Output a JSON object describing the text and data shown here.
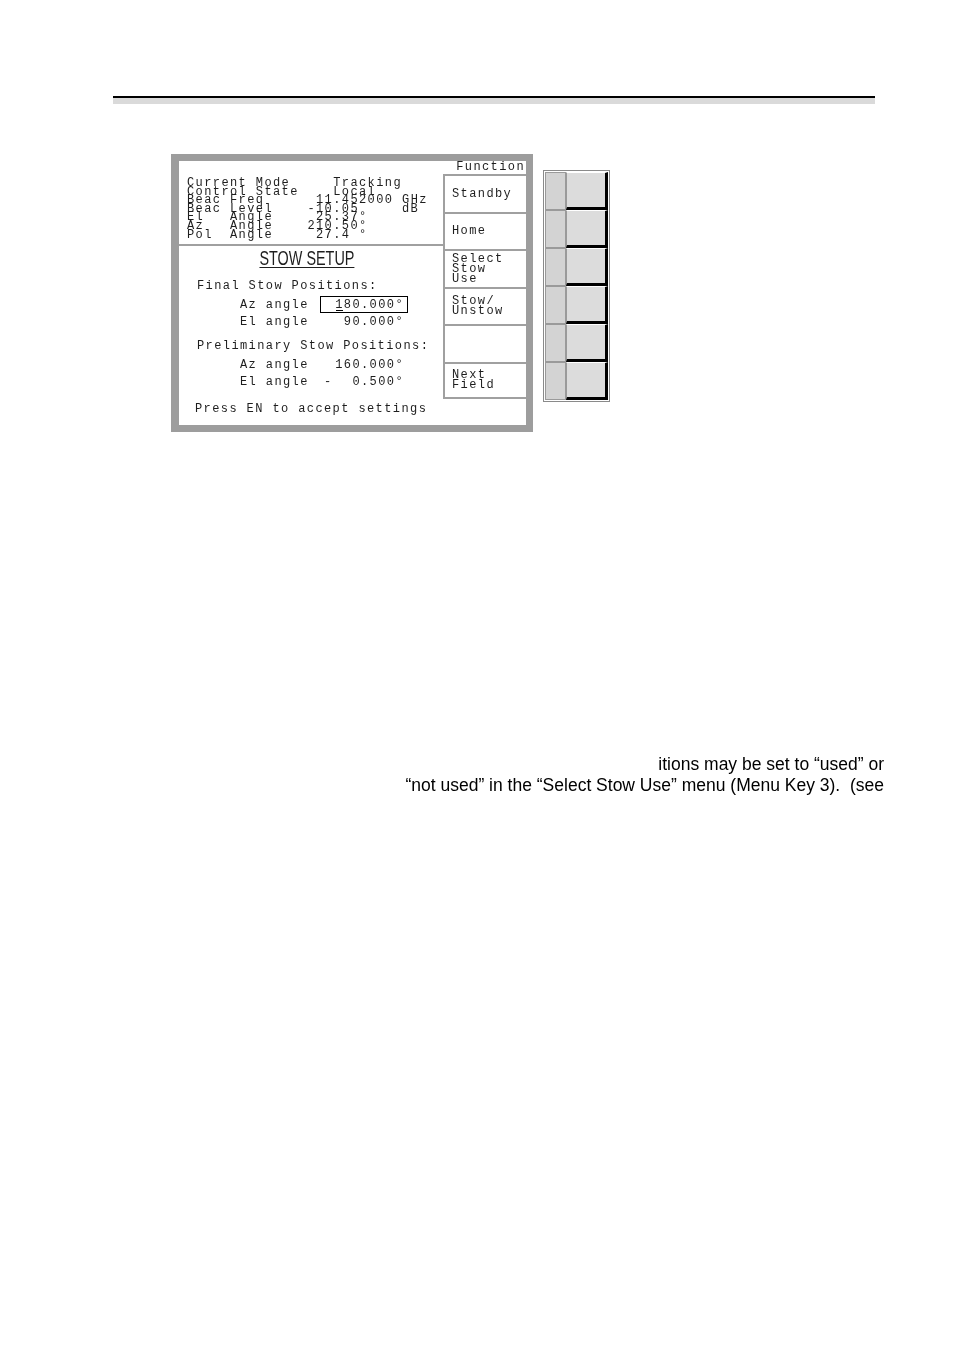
{
  "screen": {
    "status": [
      {
        "label": "Current Mode",
        "value": "Tracking"
      },
      {
        "label": "Control State",
        "value": "Local"
      },
      {
        "label": "Beac Freq",
        "value": "11.452000",
        "unit": "GHz"
      },
      {
        "label": "Beac Level",
        "value": "-10.05",
        "unit": "dB"
      },
      {
        "label": "El   Angle",
        "value": "25.37°"
      },
      {
        "label": "Az   Angle",
        "value": "210.50°"
      },
      {
        "label": "Pol  Angle",
        "value": "27.4 °"
      }
    ],
    "title": "STOW SETUP",
    "sections": [
      {
        "heading": "Final Stow Positions:",
        "fields": [
          {
            "label": "Az angle",
            "value": "180.000°",
            "selected": true
          },
          {
            "label": "El angle",
            "value": "90.000°",
            "selected": false
          }
        ]
      },
      {
        "heading": "Preliminary Stow Positions:",
        "fields": [
          {
            "label": "Az angle",
            "value": "160.000°",
            "selected": false
          },
          {
            "label": "El angle",
            "sign": "-",
            "value": "0.500°",
            "selected": false
          }
        ]
      }
    ],
    "prompt": "Press EN to accept settings",
    "softkeys": {
      "header": "Function",
      "keys": [
        {
          "kind": "label",
          "lines": [
            "Standby"
          ]
        },
        {
          "kind": "label",
          "lines": [
            "Home"
          ]
        },
        {
          "kind": "label",
          "lines": [
            "Select",
            "Stow",
            "Use"
          ]
        },
        {
          "kind": "label",
          "lines": [
            "Stow/",
            "Unstow"
          ]
        },
        {
          "kind": "blank"
        },
        {
          "kind": "label",
          "lines": [
            "Next",
            "Field"
          ]
        }
      ]
    }
  },
  "body_text": [
    "itions may be set to “used” or",
    "“not used” in the “Select Stow Use” menu (Menu Key 3).  (see"
  ]
}
